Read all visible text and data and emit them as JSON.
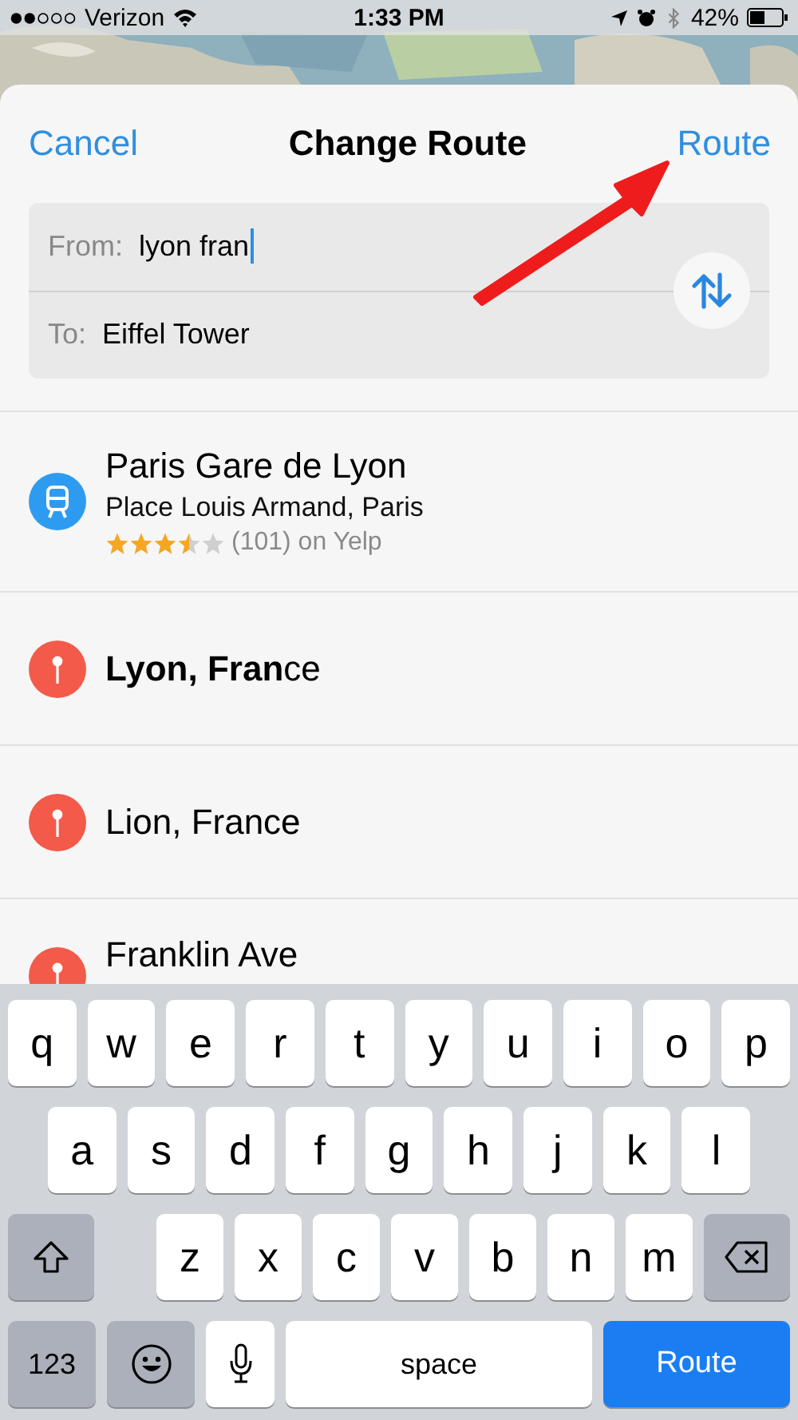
{
  "status_bar": {
    "carrier": "Verizon",
    "time": "1:33 PM",
    "battery": "42%"
  },
  "header": {
    "cancel": "Cancel",
    "title": "Change Route",
    "route": "Route"
  },
  "fields": [
    {
      "label": "From:",
      "value": "lyon fran",
      "focused": true
    },
    {
      "label": "To:",
      "value": "Eiffel Tower",
      "focused": false
    }
  ],
  "results": [
    {
      "kind": "transit",
      "title": "Paris Gare de Lyon",
      "subtitle": "Place Louis Armand, Paris",
      "stars": 3.5,
      "rating_text": "(101) on Yelp"
    },
    {
      "kind": "pin",
      "title": "**Lyon, Fran**ce"
    },
    {
      "kind": "pin",
      "title": "Lion, France"
    },
    {
      "kind": "pin",
      "title": "Franklin Ave"
    }
  ],
  "keyboard": {
    "rows": [
      {
        "keys": [
          {
            "kind": "letter",
            "label": "q"
          },
          {
            "kind": "letter",
            "label": "w"
          },
          {
            "kind": "letter",
            "label": "e"
          },
          {
            "kind": "letter",
            "label": "r"
          },
          {
            "kind": "letter",
            "label": "t"
          },
          {
            "kind": "letter",
            "label": "y"
          },
          {
            "kind": "letter",
            "label": "u"
          },
          {
            "kind": "letter",
            "label": "i"
          },
          {
            "kind": "letter",
            "label": "o"
          },
          {
            "kind": "letter",
            "label": "p"
          }
        ]
      },
      {
        "keys": [
          {
            "kind": "letter",
            "label": "a"
          },
          {
            "kind": "letter",
            "label": "s"
          },
          {
            "kind": "letter",
            "label": "d"
          },
          {
            "kind": "letter",
            "label": "f"
          },
          {
            "kind": "letter",
            "label": "g"
          },
          {
            "kind": "letter",
            "label": "h"
          },
          {
            "kind": "letter",
            "label": "j"
          },
          {
            "kind": "letter",
            "label": "k"
          },
          {
            "kind": "letter",
            "label": "l"
          }
        ]
      },
      {
        "keys": [
          {
            "kind": "shift"
          },
          {
            "kind": "letter",
            "label": "z"
          },
          {
            "kind": "letter",
            "label": "x"
          },
          {
            "kind": "letter",
            "label": "c"
          },
          {
            "kind": "letter",
            "label": "v"
          },
          {
            "kind": "letter",
            "label": "b"
          },
          {
            "kind": "letter",
            "label": "n"
          },
          {
            "kind": "letter",
            "label": "m"
          },
          {
            "kind": "delete"
          }
        ]
      },
      {
        "keys": [
          {
            "kind": "numbers",
            "label": "123"
          },
          {
            "kind": "emoji"
          },
          {
            "kind": "mic"
          },
          {
            "kind": "space",
            "label": "space"
          },
          {
            "kind": "return",
            "label": "Route"
          }
        ]
      }
    ]
  }
}
